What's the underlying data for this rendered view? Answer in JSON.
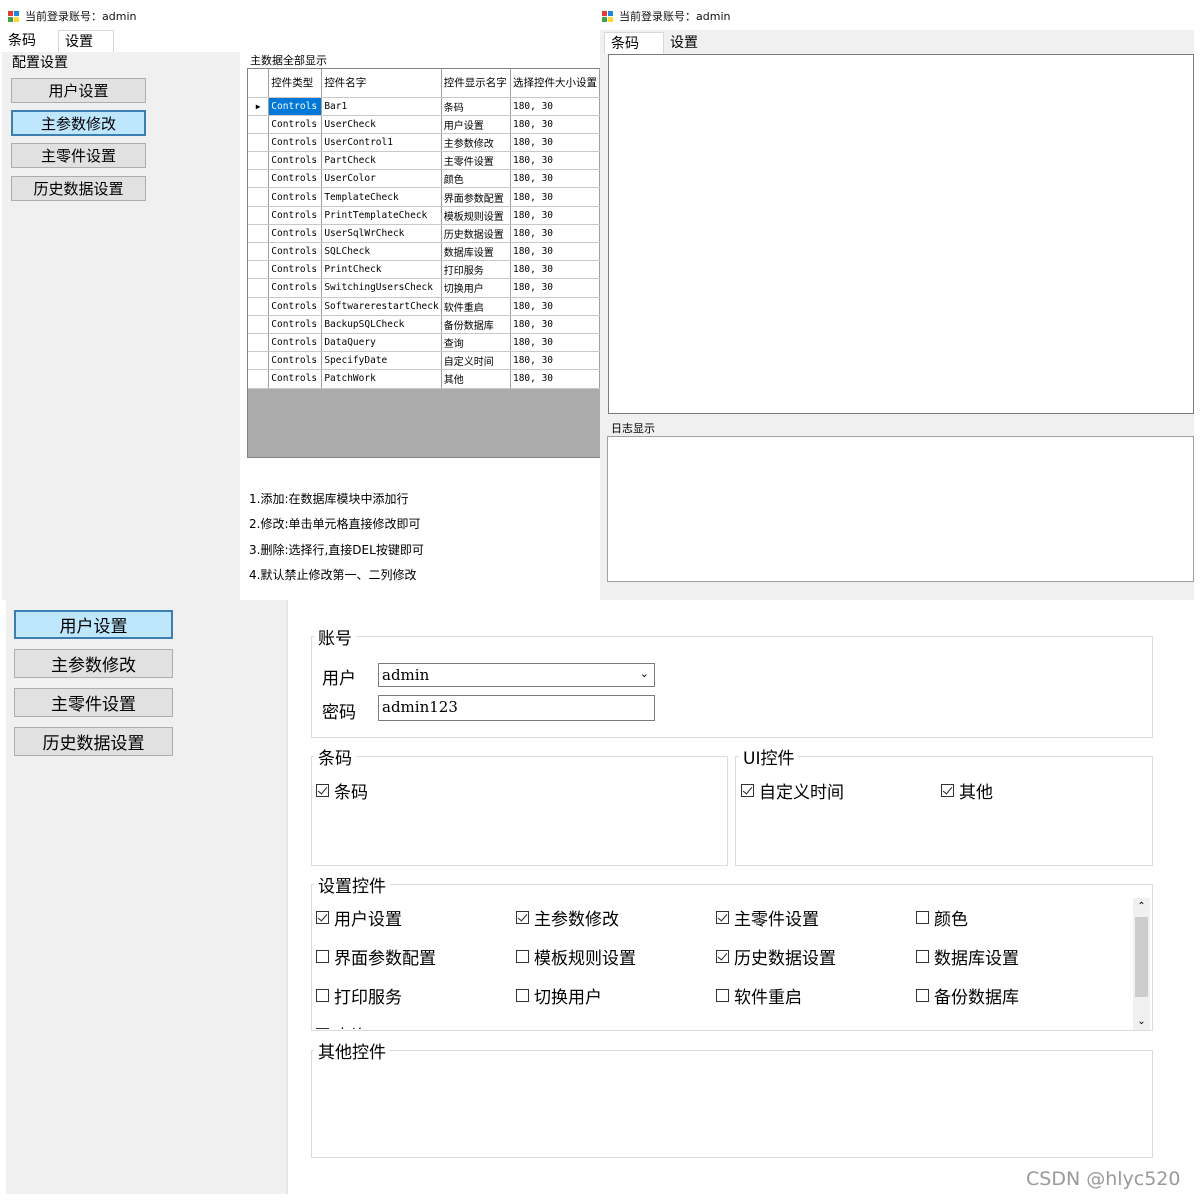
{
  "top_left": {
    "title": "当前登录账号：admin",
    "tabs": [
      "条码",
      "设置"
    ],
    "config_label": "配置设置",
    "buttons": [
      "用户设置",
      "主参数修改",
      "主零件设置",
      "历史数据设置"
    ],
    "grid_title": "主数据全部显示",
    "grid": {
      "headers": [
        "控件类型",
        "控件名字",
        "控件显示名字",
        "选择控件大小设置"
      ],
      "rows": [
        [
          "Controls",
          "Bar1",
          "条码",
          "180, 30"
        ],
        [
          "Controls",
          "UserCheck",
          "用户设置",
          "180, 30"
        ],
        [
          "Controls",
          "UserControl1",
          "主参数修改",
          "180, 30"
        ],
        [
          "Controls",
          "PartCheck",
          "主零件设置",
          "180, 30"
        ],
        [
          "Controls",
          "UserColor",
          "颜色",
          "180, 30"
        ],
        [
          "Controls",
          "TemplateCheck",
          "界面参数配置",
          "180, 30"
        ],
        [
          "Controls",
          "PrintTemplateCheck",
          "模板规则设置",
          "180, 30"
        ],
        [
          "Controls",
          "UserSqlWrCheck",
          "历史数据设置",
          "180, 30"
        ],
        [
          "Controls",
          "SQLCheck",
          "数据库设置",
          "180, 30"
        ],
        [
          "Controls",
          "PrintCheck",
          "打印服务",
          "180, 30"
        ],
        [
          "Controls",
          "SwitchingUsersCheck",
          "切换用户",
          "180, 30"
        ],
        [
          "Controls",
          "SoftwarerestartCheck",
          "软件重启",
          "180, 30"
        ],
        [
          "Controls",
          "BackupSQLCheck",
          "备份数据库",
          "180, 30"
        ],
        [
          "Controls",
          "DataQuery",
          "查询",
          "180, 30"
        ],
        [
          "Controls",
          "SpecifyDate",
          "自定义时间",
          "180, 30"
        ],
        [
          "Controls",
          "PatchWork",
          "其他",
          "180, 30"
        ]
      ]
    },
    "notes": [
      "1.添加:在数据库模块中添加行",
      "2.修改:单击单元格直接修改即可",
      "3.删除:选择行,直接DEL按键即可",
      "4.默认禁止修改第一、二列修改"
    ]
  },
  "top_right": {
    "title": "当前登录账号：admin",
    "tabs": [
      "条码",
      "设置"
    ],
    "log_label": "日志显示"
  },
  "bottom": {
    "buttons": [
      "用户设置",
      "主参数修改",
      "主零件设置",
      "历史数据设置"
    ],
    "account": {
      "title": "账号",
      "user_label": "用户",
      "user_value": "admin",
      "password_label": "密码",
      "password_value": "admin123"
    },
    "barcode_group": {
      "title": "条码",
      "items": [
        {
          "label": "条码",
          "checked": true
        }
      ]
    },
    "ui_group": {
      "title": "UI控件",
      "items": [
        {
          "label": "自定义时间",
          "checked": true
        },
        {
          "label": "其他",
          "checked": true
        }
      ]
    },
    "settings_group": {
      "title": "设置控件",
      "items": [
        {
          "label": "用户设置",
          "checked": true
        },
        {
          "label": "主参数修改",
          "checked": true
        },
        {
          "label": "主零件设置",
          "checked": true
        },
        {
          "label": "颜色",
          "checked": false
        },
        {
          "label": "界面参数配置",
          "checked": false
        },
        {
          "label": "模板规则设置",
          "checked": false
        },
        {
          "label": "历史数据设置",
          "checked": true
        },
        {
          "label": "数据库设置",
          "checked": false
        },
        {
          "label": "打印服务",
          "checked": false
        },
        {
          "label": "切换用户",
          "checked": false
        },
        {
          "label": "软件重启",
          "checked": false
        },
        {
          "label": "备份数据库",
          "checked": false
        },
        {
          "label": "查询",
          "checked": false
        }
      ]
    },
    "other_group": {
      "title": "其他控件"
    }
  },
  "watermark": "CSDN @hlyc520",
  "colors": {
    "selected_button": "#bee6fd",
    "selected_border": "#3c7fb1",
    "grid_highlight": "#0078d7"
  }
}
